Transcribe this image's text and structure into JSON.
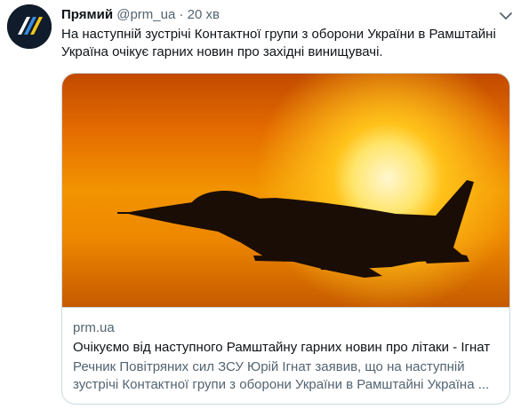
{
  "tweet": {
    "display_name": "Прямий",
    "handle": "@prm_ua",
    "separator": "·",
    "time": "20 хв",
    "text_lines": [
      "На наступній зустрічі Контактної групи з оборони України в Рамштайні",
      "Україна очікує гарних новин про західні винищувачі."
    ],
    "avatar_icon": "stripes-logo",
    "more_icon": "chevron-down-icon"
  },
  "card": {
    "image_icon": "fighter-jet-sunset-photo",
    "domain": "prm.ua",
    "title": "Очікуємо від наступного Рамштайну гарних новин про літаки - Ігнат",
    "description_lines": [
      "Речник Повітряних сил ЗСУ Юрій Ігнат заявив, що на наступній",
      "зустрічі Контактної групи з оборони України в Рамштайні Україна ..."
    ]
  },
  "colors": {
    "text_primary": "#0f1419",
    "text_secondary": "#536471",
    "border": "#cfd9de",
    "avatar_bg": "#101b2b",
    "logo_yellow": "#f5c518",
    "logo_blue": "#3a8dde"
  }
}
